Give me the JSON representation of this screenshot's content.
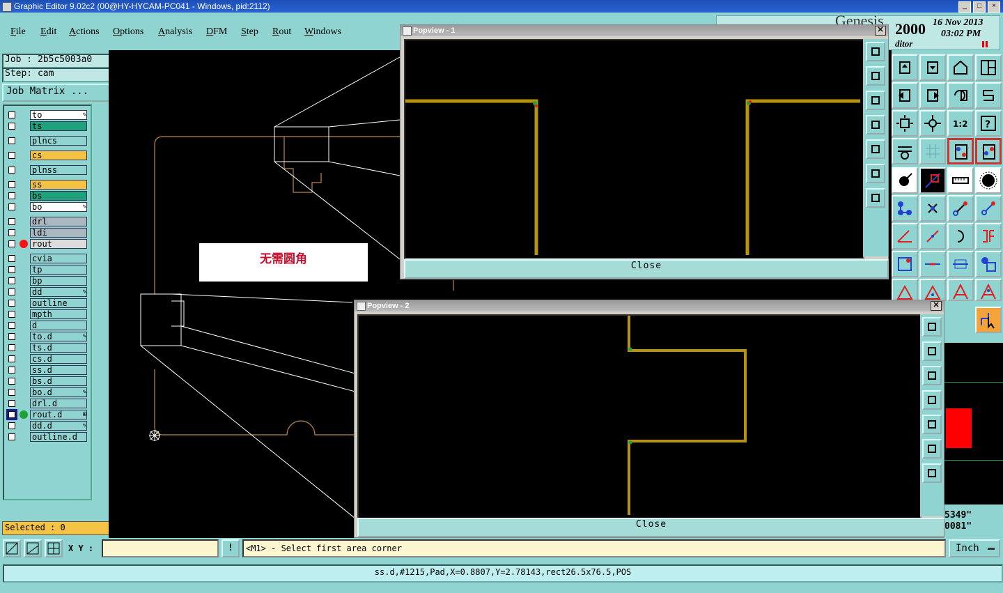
{
  "window": {
    "title": "Graphic Editor 9.02c2 (00@HY-HYCAM-PC041 - Windows, pid:2112)"
  },
  "menu": [
    "File",
    "Edit",
    "Actions",
    "Options",
    "Analysis",
    "DFM",
    "Step",
    "Rout",
    "Windows"
  ],
  "clock": {
    "year": "2000",
    "date": "16 Nov 2013",
    "time": "03:02 PM",
    "partial_title": "Genesis",
    "partial_sub": "ditor"
  },
  "job": {
    "job_label": "Job : 2b5c5003a0",
    "step_label": "Step: cam",
    "matrix_button": "Job Matrix ..."
  },
  "layers": [
    {
      "name": "to",
      "color": "#ffffff",
      "mark": "✎",
      "dot": ""
    },
    {
      "name": "ts",
      "color": "#1fa27c",
      "mark": "",
      "dot": ""
    },
    {
      "name": "plncs",
      "color": "#8fd4d0",
      "mark": "",
      "dot": ""
    },
    {
      "name": "cs",
      "color": "#f5c343",
      "mark": "",
      "dot": ""
    },
    {
      "name": "plnss",
      "color": "#8fd4d0",
      "mark": "",
      "dot": ""
    },
    {
      "name": "ss",
      "color": "#f5c343",
      "mark": "",
      "dot": ""
    },
    {
      "name": "bs",
      "color": "#1fa27c",
      "mark": "",
      "dot": ""
    },
    {
      "name": "bo",
      "color": "#ffffff",
      "mark": "✎",
      "dot": ""
    },
    {
      "name": "drl",
      "color": "#a9b8c0",
      "mark": "",
      "dot": ""
    },
    {
      "name": "ldi",
      "color": "#a9b8c0",
      "mark": "",
      "dot": ""
    },
    {
      "name": "rout",
      "color": "#dcdcdc",
      "mark": "",
      "dot": "#ff1010"
    },
    {
      "name": "cvia",
      "color": "#8fd4d0",
      "mark": "",
      "dot": ""
    },
    {
      "name": "tp",
      "color": "#8fd4d0",
      "mark": "",
      "dot": ""
    },
    {
      "name": "bp",
      "color": "#8fd4d0",
      "mark": "",
      "dot": ""
    },
    {
      "name": "dd",
      "color": "#8fd4d0",
      "mark": "✎",
      "dot": ""
    },
    {
      "name": "outline",
      "color": "#8fd4d0",
      "mark": "",
      "dot": ""
    },
    {
      "name": "mpth",
      "color": "#8fd4d0",
      "mark": "",
      "dot": ""
    },
    {
      "name": "d",
      "color": "#8fd4d0",
      "mark": "",
      "dot": ""
    },
    {
      "name": "to.d",
      "color": "#8fd4d0",
      "mark": "✎",
      "dot": ""
    },
    {
      "name": "ts.d",
      "color": "#8fd4d0",
      "mark": "",
      "dot": ""
    },
    {
      "name": "cs.d",
      "color": "#8fd4d0",
      "mark": "",
      "dot": ""
    },
    {
      "name": "ss.d",
      "color": "#8fd4d0",
      "mark": "",
      "dot": ""
    },
    {
      "name": "bs.d",
      "color": "#8fd4d0",
      "mark": "",
      "dot": ""
    },
    {
      "name": "bo.d",
      "color": "#8fd4d0",
      "mark": "✎",
      "dot": ""
    },
    {
      "name": "drl.d",
      "color": "#8fd4d0",
      "mark": "",
      "dot": ""
    },
    {
      "name": "rout.d",
      "color": "#8fd4d0",
      "mark": "⊞",
      "dot": "#1fa237"
    },
    {
      "name": "dd.d",
      "color": "#8fd4d0",
      "mark": "✎",
      "dot": ""
    },
    {
      "name": "outline.d",
      "color": "#8fd4d0",
      "mark": "",
      "dot": ""
    }
  ],
  "selected": {
    "label": "Selected : 0"
  },
  "annotation": {
    "text": "无需圆角"
  },
  "popview1": {
    "title": "Popview - 1",
    "close_label": "Close"
  },
  "popview2": {
    "title": "Popview - 2",
    "close_label": "Close"
  },
  "coords": {
    "line1": "5349\"",
    "line2": "0081\""
  },
  "status": {
    "xy_label": "X Y :",
    "xy_value": "",
    "prompt": "<M1> - Select first area corner",
    "units": "Inch"
  },
  "feature_info": "ss.d,#1215,Pad,X=0.8807,Y=2.78143,rect26.5x76.5,POS",
  "colors": {
    "panel": "#8fd4d0",
    "trace": "#b8930e",
    "outline_line": "#b88a4a"
  }
}
